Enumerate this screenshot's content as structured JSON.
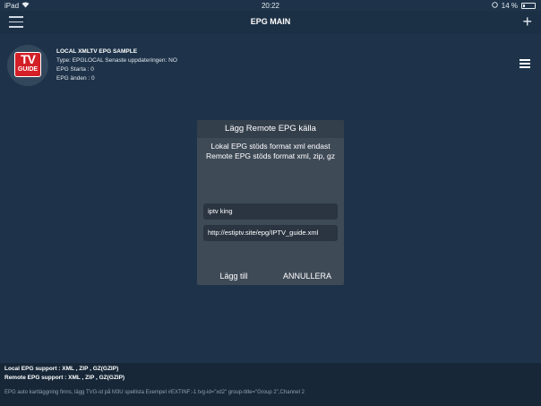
{
  "status_bar": {
    "device": "iPad",
    "time": "20:22",
    "battery_percent": "14 %"
  },
  "nav": {
    "title": "EPG MAIN"
  },
  "epg_item": {
    "logo_line1": "TV",
    "logo_line2": "GUIDE",
    "name": "LOCAL XMLTV EPG SAMPLE",
    "type_line": "Type: EPGLOCAL Senaste uppdateringen: NO",
    "start_line": "EPG Starta : 0",
    "end_line": "EPG änden : 0"
  },
  "dialog": {
    "title": "Lägg Remote EPG källa",
    "message_line1": "Lokal EPG stöds format xml endast",
    "message_line2": "Remote EPG stöds format xml, zip, gz",
    "name_value": "iptv king",
    "url_value": "http://estiptv.site/epg/IPTV_guide.xml",
    "add_label": "Lägg till",
    "cancel_label": "ANNULLERA"
  },
  "footer": {
    "local_support": "Local EPG support : XML , ZIP , GZ(GZIP)",
    "remote_support": "Remote EPG support : XML , ZIP , GZ(GZIP)",
    "note": "EPG auto kartläggning finns, lägg TVG-id på M3U spellista Exempel #EXTINF:-1 tvg-id=\"xd2\" group-title=\"Group 2\",Channel 2"
  },
  "colors": {
    "background": "#1e3349",
    "dialog": "#3f4a57",
    "logo_red": "#d41f27"
  }
}
